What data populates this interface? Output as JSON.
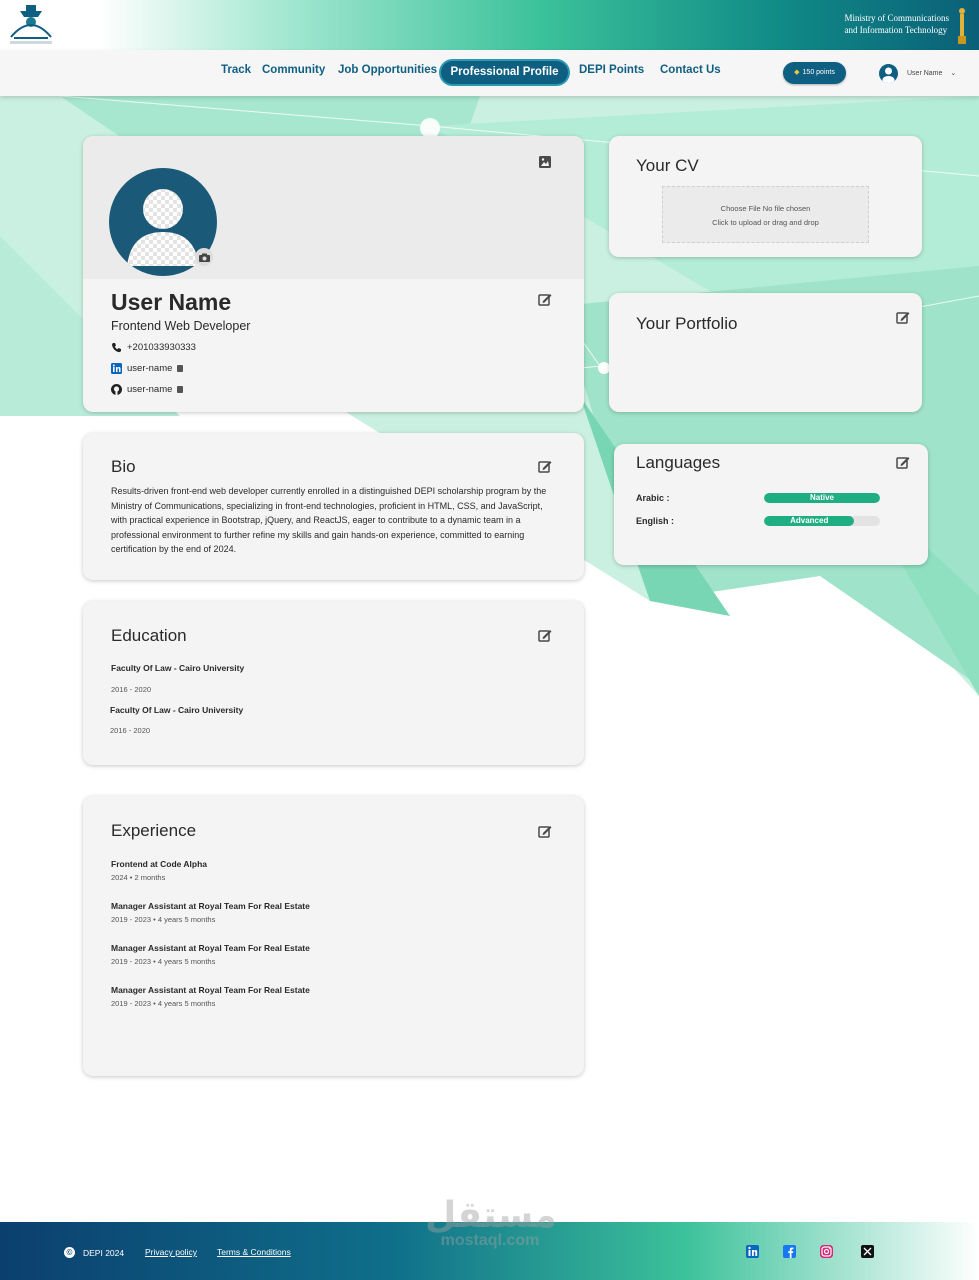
{
  "header": {
    "logo_text": "Digital Egypt Pioneers",
    "ministry_line1": "Ministry of Communications",
    "ministry_line2": "and Information Technology"
  },
  "nav": {
    "links": [
      "Track",
      "Community",
      "Job Opportunities",
      "Professional Profile",
      "DEPI Points",
      "Contact Us"
    ],
    "active": "Professional Profile",
    "points_label": "150 points",
    "user_name": "User Name"
  },
  "profile": {
    "name": "User Name",
    "title": "Frontend Web Developer",
    "phone": "+201033930333",
    "linkedin": "user-name",
    "github": "user-name"
  },
  "bio": {
    "title": "Bio",
    "text": "Results-driven front-end web developer currently enrolled in a distinguished DEPI scholarship program by the Ministry of Communications, specializing in front-end technologies, proficient in HTML, CSS, and JavaScript, with practical experience in Bootstrap, jQuery, and ReactJS, eager to contribute to a dynamic team in a professional environment to further refine my skills and gain hands-on experience, committed to earning certification by the end of 2024."
  },
  "education": {
    "title": "Education",
    "items": [
      {
        "school": "Faculty Of Law - Cairo University",
        "dates": "2016 - 2020"
      },
      {
        "school": "Faculty Of Law - Cairo University",
        "dates": "2016 - 2020"
      }
    ]
  },
  "experience": {
    "title": "Experience",
    "items": [
      {
        "role": "Frontend at Code Alpha",
        "duration": "2024 • 2 months"
      },
      {
        "role": "Manager Assistant at Royal Team For Real Estate",
        "duration": "2019 - 2023 • 4 years 5 months"
      },
      {
        "role": "Manager Assistant at Royal Team For Real Estate",
        "duration": "2019 - 2023 • 4 years 5 months"
      },
      {
        "role": "Manager Assistant at Royal Team For Real Estate",
        "duration": "2019 - 2023 • 4 years 5 months"
      }
    ]
  },
  "cv": {
    "title": "Your CV",
    "file_status": "Choose File   No file chosen",
    "hint": "Click to upload or drag and drop"
  },
  "portfolio": {
    "title": "Your Portfolio"
  },
  "languages": {
    "title": "Languages",
    "items": [
      {
        "label": "Arabic :",
        "level": "Native",
        "fill": 1.0
      },
      {
        "label": "English :",
        "level": "Advanced",
        "fill": 0.78
      }
    ]
  },
  "footer": {
    "copyright": "DEPI 2024",
    "privacy": "Privacy policy",
    "terms": "Terms & Conditions",
    "social": [
      "linkedin-icon",
      "facebook-icon",
      "instagram-icon",
      "x-icon"
    ]
  },
  "watermark": {
    "arabic": "مستقل",
    "latin": "mostaql.com"
  },
  "colors": {
    "primary": "#0f5f82",
    "accent": "#1fae82",
    "card": "#f4f4f4"
  }
}
